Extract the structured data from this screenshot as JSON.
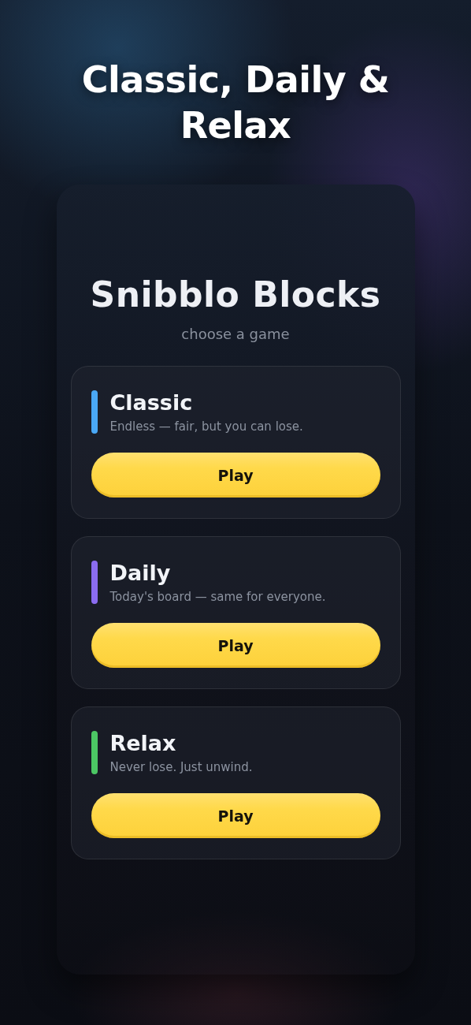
{
  "headline": "Classic, Daily & Relax",
  "panel": {
    "title": "Snibblo Blocks",
    "subtitle": "choose a game",
    "modes": [
      {
        "name": "Classic",
        "description": "Endless — fair, but you can lose.",
        "color": "#4aa8f5",
        "button": "Play"
      },
      {
        "name": "Daily",
        "description": "Today's board — same for everyone.",
        "color": "#8b6cf0",
        "button": "Play"
      },
      {
        "name": "Relax",
        "description": "Never lose. Just unwind.",
        "color": "#4cc764",
        "button": "Play"
      }
    ]
  }
}
